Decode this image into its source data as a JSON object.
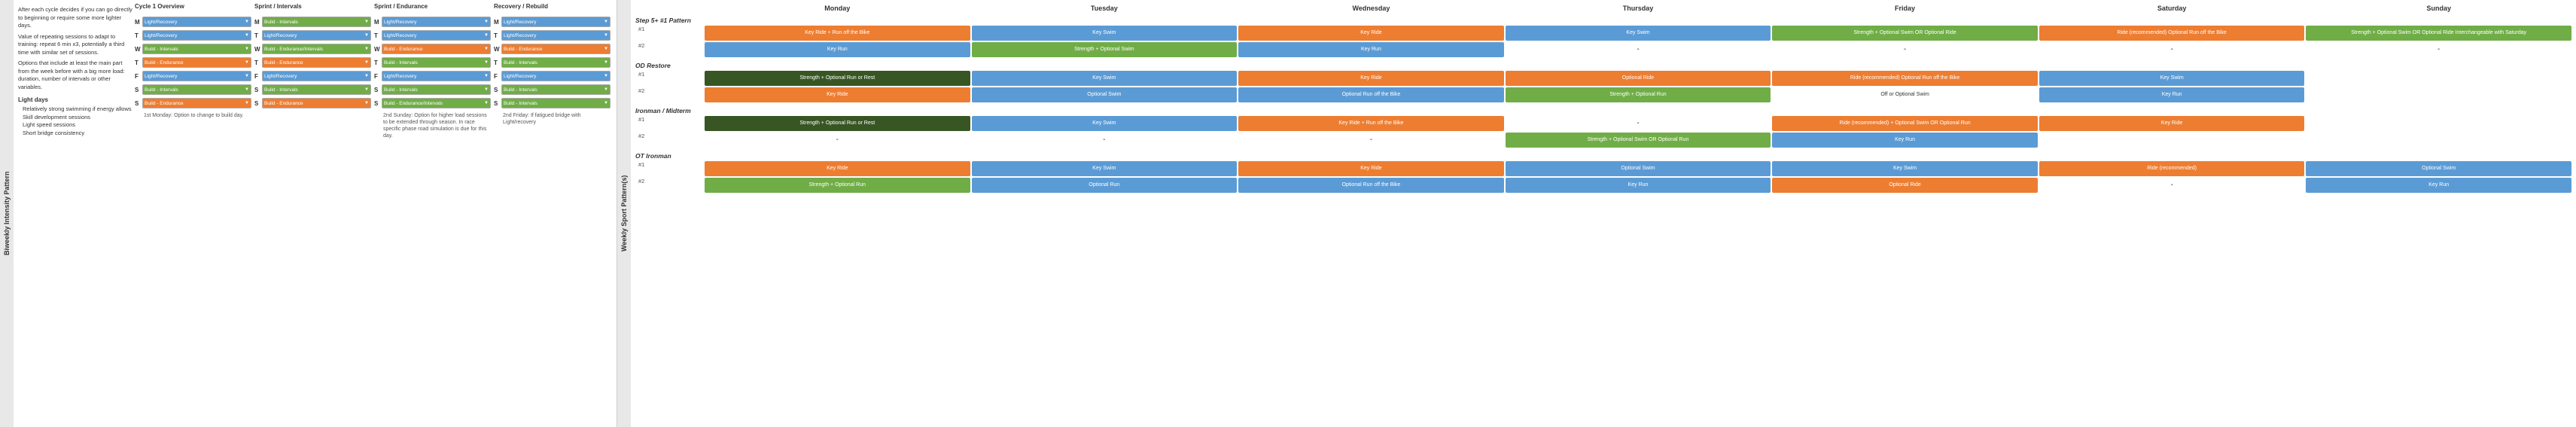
{
  "left_panel": {
    "vertical_label": "Biweekly Intensity Pattern",
    "notes": {
      "title": "",
      "paragraphs": [
        "After each cycle decides if you can go directly to beginning or require some more lighter days.",
        "Value of repeating sessions to adapt to training: repeat 6 min x3, potentially a third time with similar set of sessions.",
        "Options that include at least the main part from the week before with a big more load: duration, number of intervals or other variables."
      ],
      "light_days_title": "Light days",
      "light_days_items": [
        "Relatively strong swimming if energy allows",
        "Skill development sessions",
        "Light speed sessions",
        "Short bridge consistency"
      ]
    },
    "weeks": [
      {
        "header": "Cycle 1 Overview",
        "annotation": "1st Monday: Option to change to build day.",
        "days": [
          {
            "label": "M",
            "workout": "Light/Recovery",
            "type": "light"
          },
          {
            "label": "T",
            "workout": "Light/Recovery",
            "type": "light"
          },
          {
            "label": "W",
            "workout": "Build - Intervals",
            "type": "build-intervals"
          },
          {
            "label": "T",
            "workout": "Build - Endurance",
            "type": "build-endurance"
          },
          {
            "label": "F",
            "workout": "Light/Recovery",
            "type": "light"
          },
          {
            "label": "S",
            "workout": "Build - Intervals",
            "type": "build-intervals"
          },
          {
            "label": "S",
            "workout": "Build - Endurance",
            "type": "build-endurance"
          }
        ]
      },
      {
        "header": "Sprint / Intervals",
        "annotation": "",
        "days": [
          {
            "label": "M",
            "workout": "Build - Intervals",
            "type": "build-intervals"
          },
          {
            "label": "T",
            "workout": "Light/Recovery",
            "type": "light"
          },
          {
            "label": "W",
            "workout": "Build - Endurance/Intervals",
            "type": "build-intervals"
          },
          {
            "label": "T",
            "workout": "Build - Endurance",
            "type": "build-endurance"
          },
          {
            "label": "F",
            "workout": "Light/Recovery",
            "type": "light"
          },
          {
            "label": "S",
            "workout": "Build - Intervals",
            "type": "build-intervals"
          },
          {
            "label": "S",
            "workout": "Build - Endurance",
            "type": "build-endurance"
          }
        ]
      },
      {
        "header": "Sprint / Endurance",
        "annotation": "2nd Sunday: Option for higher load sessions to be extended through season. In race specific phase road simulation is due for this day.",
        "days": [
          {
            "label": "M",
            "workout": "Light/Recovery",
            "type": "light"
          },
          {
            "label": "T",
            "workout": "Light/Recovery",
            "type": "light"
          },
          {
            "label": "W",
            "workout": "Build - Endurance",
            "type": "build-endurance"
          },
          {
            "label": "T",
            "workout": "Build - Intervals",
            "type": "build-intervals"
          },
          {
            "label": "F",
            "workout": "Light/Recovery",
            "type": "light"
          },
          {
            "label": "S",
            "workout": "Build - Intervals",
            "type": "build-intervals"
          },
          {
            "label": "S",
            "workout": "Build - Endurance/Intervals",
            "type": "build-intervals"
          }
        ]
      },
      {
        "header": "Recovery / Rebuild",
        "annotation": "2nd Friday: If fatigued bridge with Light/recovery",
        "days": [
          {
            "label": "M",
            "workout": "Light/Recovery",
            "type": "light"
          },
          {
            "label": "T",
            "workout": "Light/Recovery",
            "type": "light"
          },
          {
            "label": "W",
            "workout": "Build - Endurance",
            "type": "build-endurance"
          },
          {
            "label": "T",
            "workout": "Build - Intervals",
            "type": "build-intervals"
          },
          {
            "label": "F",
            "workout": "Light/Recovery",
            "type": "light"
          },
          {
            "label": "S",
            "workout": "Build - Intervals",
            "type": "build-intervals"
          },
          {
            "label": "S",
            "workout": "Build - Intervals",
            "type": "build-intervals"
          }
        ]
      }
    ]
  },
  "right_panel": {
    "vertical_label": "Weekly Sport Pattern(s)",
    "days": [
      "Monday",
      "Tuesday",
      "Wednesday",
      "Thursday",
      "Friday",
      "Saturday",
      "Sunday"
    ],
    "sections": [
      {
        "title": "Step 5+ #1 Pattern",
        "rows": [
          {
            "label": "#1",
            "cells": [
              {
                "text": "Key Ride + Run off the Bike",
                "type": "orange"
              },
              {
                "text": "Key Swim",
                "type": "blue"
              },
              {
                "text": "Key Ride",
                "type": "orange"
              },
              {
                "text": "Key Swim",
                "type": "blue"
              },
              {
                "text": "Strength + Optional Swim OR Optional Ride",
                "type": "green"
              },
              {
                "text": "Ride (recommended) Optional Run off the Bike",
                "type": "orange"
              },
              {
                "text": "Strength + Optional Swim OR Optional Ride Interchangeable with Saturday",
                "type": "green"
              }
            ]
          },
          {
            "label": "#2",
            "cells": [
              {
                "text": "Key Run",
                "type": "blue"
              },
              {
                "text": "Strength + Optional Swim",
                "type": "green"
              },
              {
                "text": "Key Run",
                "type": "blue"
              },
              {
                "text": "-",
                "type": "dash"
              },
              {
                "text": "-",
                "type": "dash"
              },
              {
                "text": "-",
                "type": "dash"
              },
              {
                "text": "-",
                "type": "dash"
              }
            ]
          }
        ]
      },
      {
        "title": "OD Restore",
        "rows": [
          {
            "label": "#1",
            "cells": [
              {
                "text": "Strength + Optional Run or Rest",
                "type": "dark-green"
              },
              {
                "text": "Key Swim",
                "type": "blue"
              },
              {
                "text": "Key Ride",
                "type": "orange"
              },
              {
                "text": "Optional Ride",
                "type": "orange"
              },
              {
                "text": "Ride (recommended) Optional Run off the Bike",
                "type": "orange"
              },
              {
                "text": "Key Swim",
                "type": "blue"
              },
              {
                "text": "",
                "type": "empty"
              }
            ]
          },
          {
            "label": "#2",
            "cells": [
              {
                "text": "Key Ride",
                "type": "orange"
              },
              {
                "text": "Optional Swim",
                "type": "blue"
              },
              {
                "text": "Optional Run off the Bike",
                "type": "blue"
              },
              {
                "text": "Strength + Optional Run",
                "type": "green"
              },
              {
                "text": "Off or Optional Swim",
                "type": "empty"
              },
              {
                "text": "Key Run",
                "type": "blue"
              },
              {
                "text": "",
                "type": "empty"
              }
            ]
          }
        ]
      },
      {
        "title": "Ironman / Midterm",
        "rows": [
          {
            "label": "#1",
            "cells": [
              {
                "text": "Strength + Optional Run or Rest",
                "type": "dark-green"
              },
              {
                "text": "Key Swim",
                "type": "blue"
              },
              {
                "text": "Key Ride + Run off the Bike",
                "type": "orange"
              },
              {
                "text": "-",
                "type": "dash"
              },
              {
                "text": "Ride (recommended) + Optional Swim OR Optional Run",
                "type": "orange"
              },
              {
                "text": "Key Ride",
                "type": "orange"
              },
              {
                "text": "",
                "type": "empty"
              }
            ]
          },
          {
            "label": "#2",
            "cells": [
              {
                "text": "-",
                "type": "dash"
              },
              {
                "text": "-",
                "type": "dash"
              },
              {
                "text": "-",
                "type": "dash"
              },
              {
                "text": "Strength + Optional Swim OR Optional Run",
                "type": "green"
              },
              {
                "text": "Key Run",
                "type": "blue"
              },
              {
                "text": "",
                "type": "empty"
              },
              {
                "text": "",
                "type": "empty"
              }
            ]
          }
        ]
      },
      {
        "title": "OT Ironman",
        "rows": [
          {
            "label": "#1",
            "cells": [
              {
                "text": "Key Ride",
                "type": "orange"
              },
              {
                "text": "Key Swim",
                "type": "blue"
              },
              {
                "text": "Key Ride",
                "type": "orange"
              },
              {
                "text": "Optional Swim",
                "type": "blue"
              },
              {
                "text": "Key Swim",
                "type": "blue"
              },
              {
                "text": "Ride (recommended)",
                "type": "orange"
              },
              {
                "text": "Optional Swim",
                "type": "blue"
              }
            ]
          },
          {
            "label": "#2",
            "cells": [
              {
                "text": "Strength + Optional Run",
                "type": "green"
              },
              {
                "text": "Optional Run",
                "type": "blue"
              },
              {
                "text": "Optional Run off the Bike",
                "type": "blue"
              },
              {
                "text": "Key Run",
                "type": "blue"
              },
              {
                "text": "Optional Ride",
                "type": "orange"
              },
              {
                "text": "-",
                "type": "dash"
              },
              {
                "text": "Key Run",
                "type": "blue"
              }
            ]
          }
        ]
      }
    ]
  }
}
